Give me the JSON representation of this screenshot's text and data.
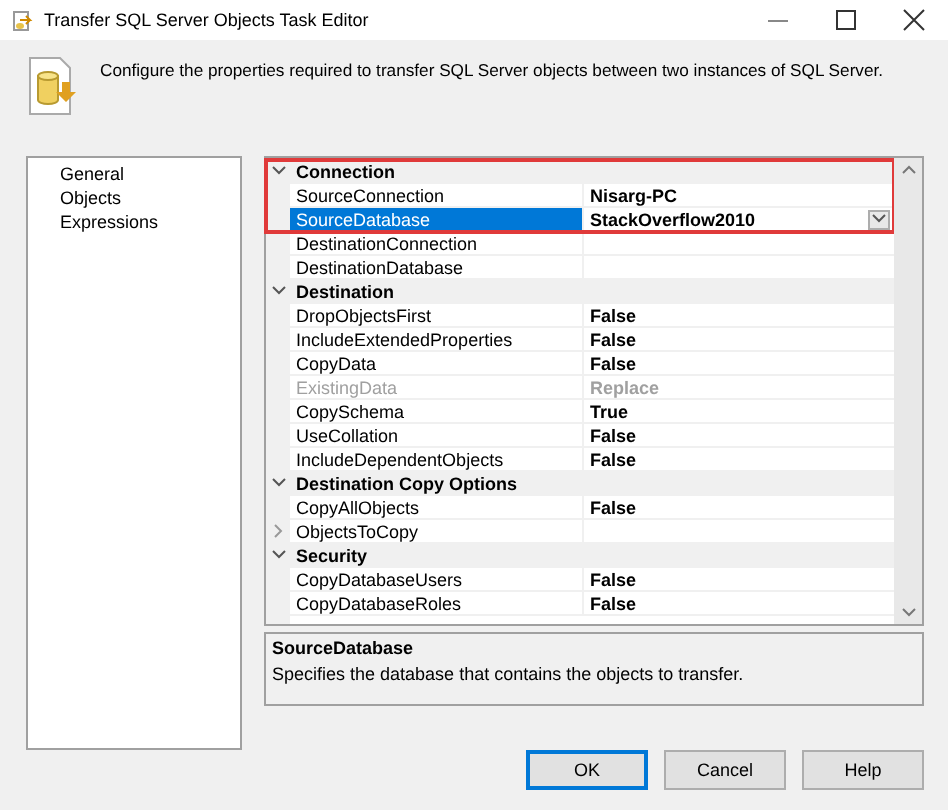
{
  "window": {
    "title": "Transfer SQL Server Objects Task Editor"
  },
  "header": {
    "text": "Configure the properties required to transfer SQL Server objects between two instances of SQL Server."
  },
  "nav": {
    "items": [
      {
        "label": "General"
      },
      {
        "label": "Objects"
      },
      {
        "label": "Expressions"
      }
    ]
  },
  "properties": {
    "rows": [
      {
        "kind": "category",
        "name": "Connection",
        "expanded": true,
        "highlighted": true
      },
      {
        "kind": "property",
        "name": "SourceConnection",
        "value": "Nisarg-PC",
        "selected": false,
        "disabled": false,
        "dropdown": false,
        "highlighted": true
      },
      {
        "kind": "property",
        "name": "SourceDatabase",
        "value": "StackOverflow2010",
        "selected": true,
        "disabled": false,
        "dropdown": true,
        "highlighted": true
      },
      {
        "kind": "property",
        "name": "DestinationConnection",
        "selected": false,
        "disabled": false,
        "dropdown": false,
        "highlighted": false
      },
      {
        "kind": "property",
        "name": "DestinationDatabase",
        "selected": false,
        "disabled": false,
        "dropdown": false,
        "highlighted": false
      },
      {
        "kind": "category",
        "name": "Destination",
        "expanded": true,
        "highlighted": false
      },
      {
        "kind": "property",
        "name": "DropObjectsFirst",
        "value": "False",
        "selected": false,
        "disabled": false,
        "dropdown": false,
        "highlighted": false
      },
      {
        "kind": "property",
        "name": "IncludeExtendedProperties",
        "value": "False",
        "selected": false,
        "disabled": false,
        "dropdown": false,
        "highlighted": false
      },
      {
        "kind": "property",
        "name": "CopyData",
        "value": "False",
        "selected": false,
        "disabled": false,
        "dropdown": false,
        "highlighted": false
      },
      {
        "kind": "property",
        "name": "ExistingData",
        "value": "Replace",
        "selected": false,
        "disabled": true,
        "dropdown": false,
        "highlighted": false
      },
      {
        "kind": "property",
        "name": "CopySchema",
        "value": "True",
        "selected": false,
        "disabled": false,
        "dropdown": false,
        "highlighted": false
      },
      {
        "kind": "property",
        "name": "UseCollation",
        "value": "False",
        "selected": false,
        "disabled": false,
        "dropdown": false,
        "highlighted": false
      },
      {
        "kind": "property",
        "name": "IncludeDependentObjects",
        "value": "False",
        "selected": false,
        "disabled": false,
        "dropdown": false,
        "highlighted": false
      },
      {
        "kind": "category",
        "name": "Destination Copy Options",
        "expanded": true,
        "highlighted": false
      },
      {
        "kind": "property",
        "name": "CopyAllObjects",
        "value": "False",
        "selected": false,
        "disabled": false,
        "dropdown": false,
        "highlighted": false
      },
      {
        "kind": "group",
        "name": "ObjectsToCopy",
        "expanded": false,
        "highlighted": false
      },
      {
        "kind": "category",
        "name": "Security",
        "expanded": true,
        "highlighted": false
      },
      {
        "kind": "property",
        "name": "CopyDatabaseUsers",
        "value": "False",
        "selected": false,
        "disabled": false,
        "dropdown": false,
        "highlighted": false
      },
      {
        "kind": "property",
        "name": "CopyDatabaseRoles",
        "value": "False",
        "selected": false,
        "disabled": false,
        "dropdown": false,
        "highlighted": false
      }
    ]
  },
  "description": {
    "title": "SourceDatabase",
    "text": "Specifies the database that contains the objects to transfer."
  },
  "buttons": [
    {
      "label": "OK",
      "default": true
    },
    {
      "label": "Cancel",
      "default": false
    },
    {
      "label": "Help",
      "default": false
    }
  ]
}
